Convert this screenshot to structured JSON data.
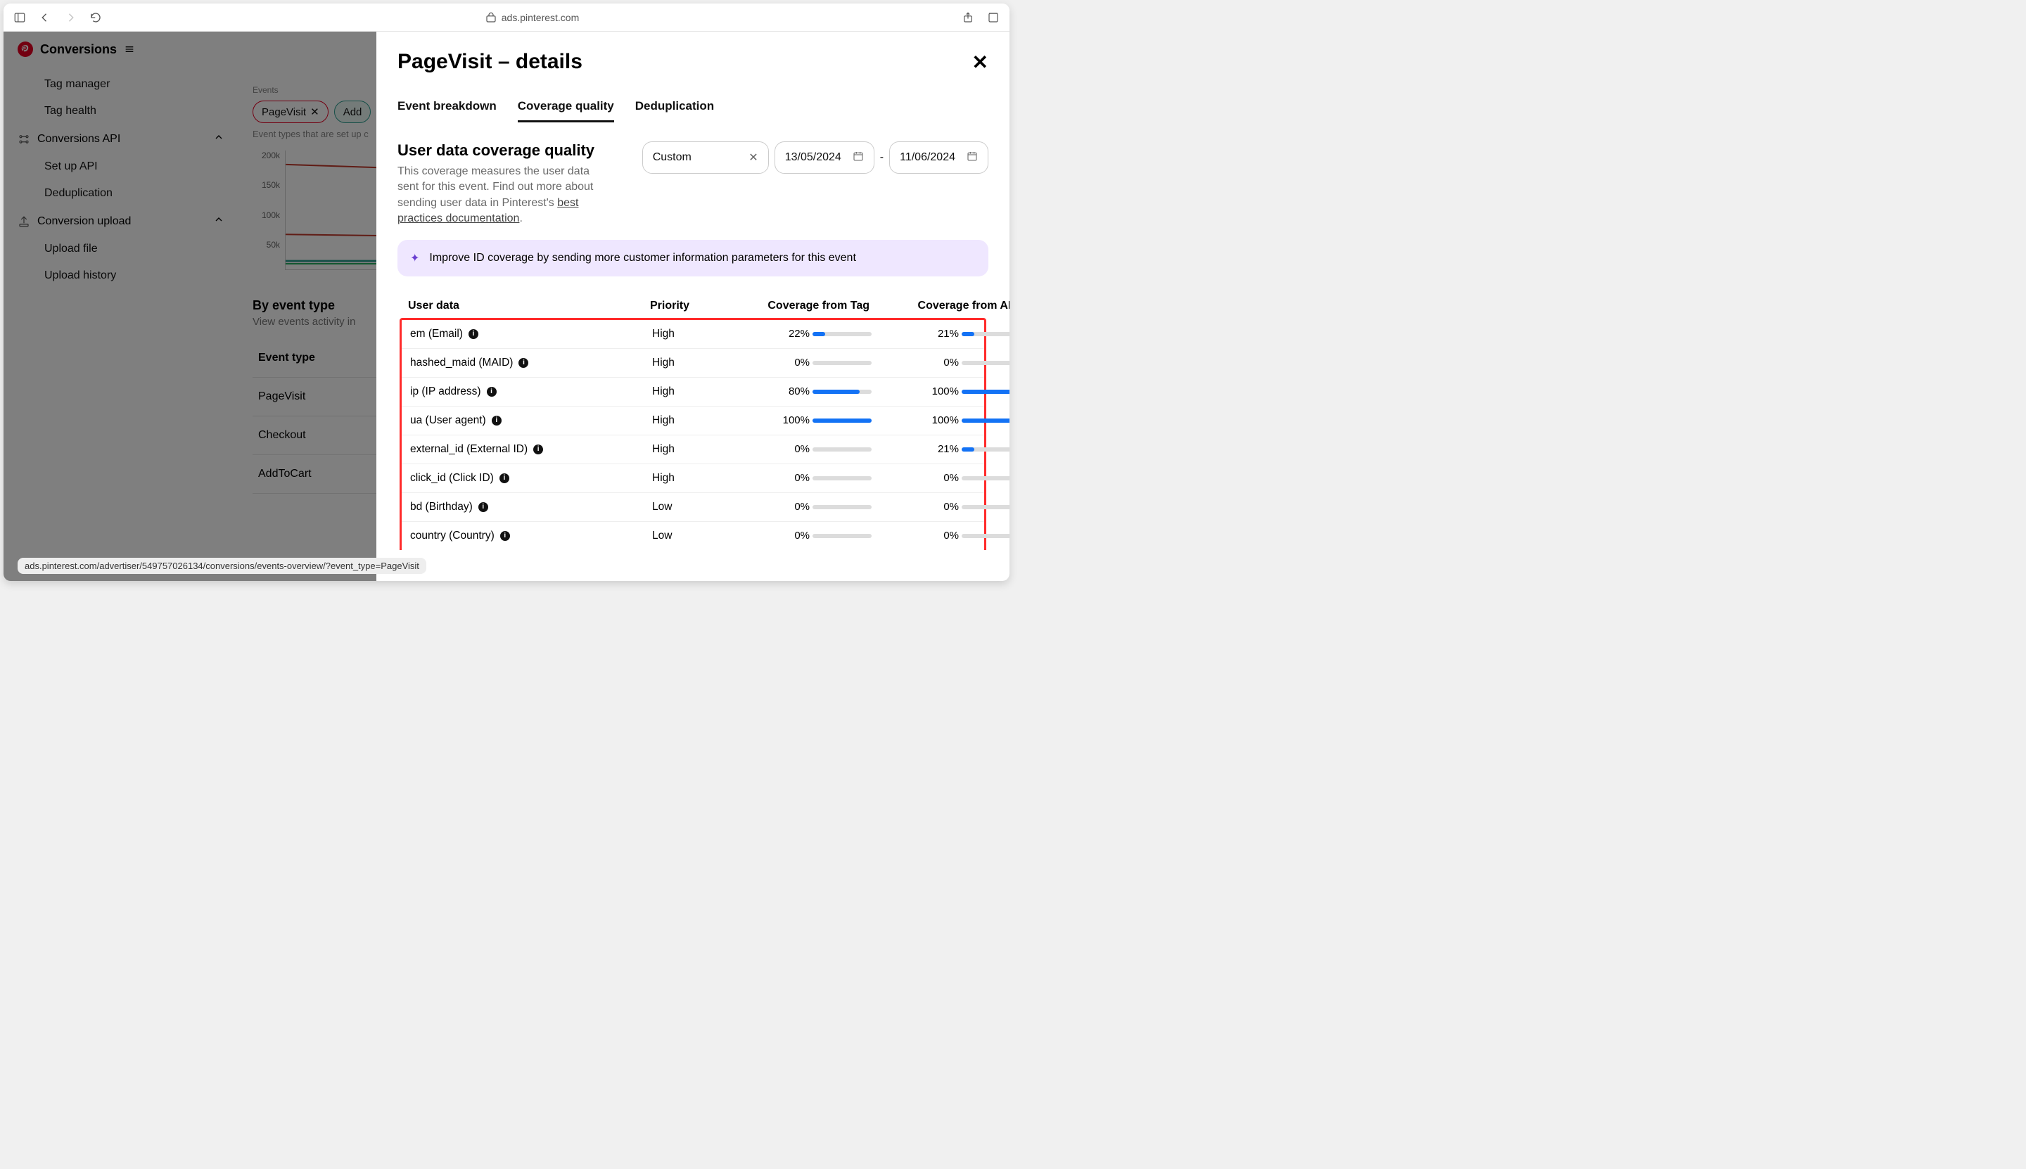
{
  "browser": {
    "url": "ads.pinterest.com"
  },
  "app": {
    "title": "Conversions"
  },
  "sidebar": {
    "items": [
      {
        "label": "Tag manager"
      },
      {
        "label": "Tag health"
      }
    ],
    "groups": [
      {
        "label": "Conversions API",
        "items": [
          {
            "label": "Set up API"
          },
          {
            "label": "Deduplication"
          }
        ]
      },
      {
        "label": "Conversion upload",
        "items": [
          {
            "label": "Upload file"
          },
          {
            "label": "Upload history"
          }
        ]
      }
    ]
  },
  "events": {
    "label": "Events",
    "chips": [
      {
        "label": "PageVisit",
        "removable": true
      },
      {
        "label": "Add"
      }
    ],
    "desc": "Event types that are set up c",
    "yticks": [
      "200k",
      "150k",
      "100k",
      "50k"
    ]
  },
  "byType": {
    "heading": "By event type",
    "sub": "View events activity in",
    "colhead": "Event type",
    "rows": [
      "PageVisit",
      "Checkout",
      "AddToCart"
    ]
  },
  "drawer": {
    "title": "PageVisit – details",
    "tabs": [
      "Event breakdown",
      "Coverage quality",
      "Deduplication"
    ],
    "activeTab": 1,
    "coverage": {
      "title": "User data coverage quality",
      "desc_a": "This coverage measures the user data sent for this event. Find out more about sending user data in Pinterest's ",
      "link": "best practices documentation",
      "desc_b": "."
    },
    "range": {
      "preset": "Custom",
      "from": "13/05/2024",
      "to": "11/06/2024",
      "sep": "-"
    },
    "banner": "Improve ID coverage by sending more customer information parameters for this event",
    "columns": [
      "User data",
      "Priority",
      "Coverage from Tag",
      "Coverage from API"
    ],
    "rows": [
      {
        "name": "em (Email)",
        "priority": "High",
        "tag": 22,
        "api": 21
      },
      {
        "name": "hashed_maid (MAID)",
        "priority": "High",
        "tag": 0,
        "api": 0
      },
      {
        "name": "ip (IP address)",
        "priority": "High",
        "tag": 80,
        "api": 100
      },
      {
        "name": "ua (User agent)",
        "priority": "High",
        "tag": 100,
        "api": 100
      },
      {
        "name": "external_id (External ID)",
        "priority": "High",
        "tag": 0,
        "api": 21
      },
      {
        "name": "click_id (Click ID)",
        "priority": "High",
        "tag": 0,
        "api": 0
      },
      {
        "name": "bd (Birthday)",
        "priority": "Low",
        "tag": 0,
        "api": 0
      },
      {
        "name": "country (Country)",
        "priority": "Low",
        "tag": 0,
        "api": 0
      }
    ]
  },
  "status_url": "ads.pinterest.com/advertiser/549757026134/conversions/events-overview/?event_type=PageVisit"
}
